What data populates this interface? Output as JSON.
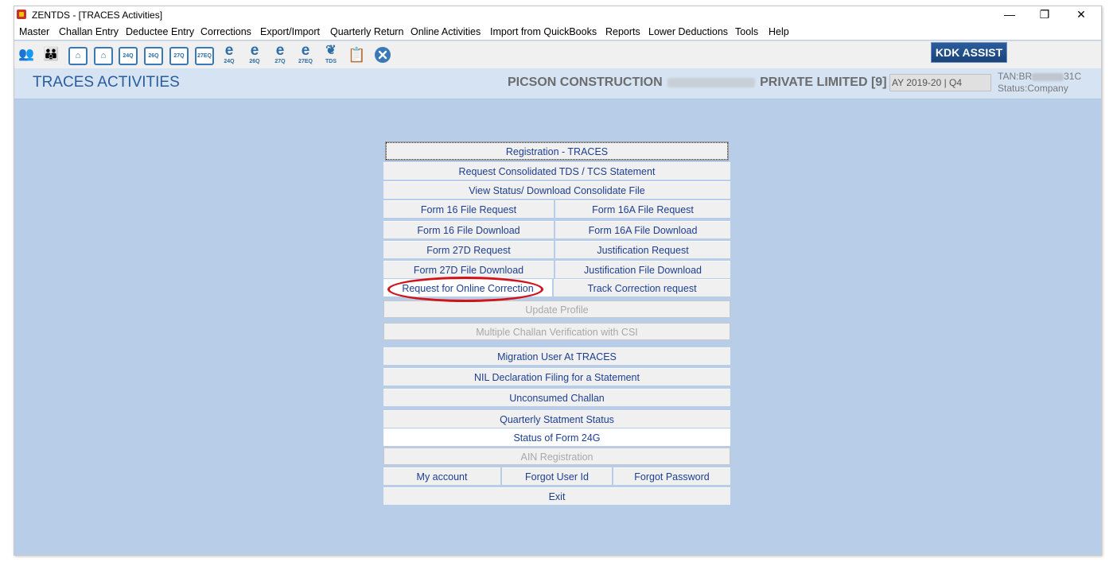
{
  "window": {
    "title": "ZENTDS - [TRACES Activities]",
    "controls": {
      "minimize": "—",
      "restore": "❐",
      "close": "✕"
    }
  },
  "menu": [
    "Master",
    "Challan Entry",
    "Deductee Entry",
    "Corrections",
    "Export/Import",
    "Quarterly Return",
    "Online Activities",
    "Import from QuickBooks",
    "Reports",
    "Lower Deductions",
    "Tools",
    "Help"
  ],
  "toolbar": {
    "icons": [
      "users-icon",
      "group-icon",
      "person-icon",
      "person-icon",
      "form-24q-icon",
      "form-26q-icon",
      "form-27q-icon",
      "form-27eq-icon",
      "e-24q-icon",
      "e-26q-icon",
      "e-27q-icon",
      "e-27eq-icon",
      "tds-icon",
      "document-icon",
      "close-circle-icon"
    ],
    "box_labels": [
      "24Q",
      "26Q",
      "27Q",
      "27EQ"
    ],
    "e_labels": [
      "24Q",
      "26Q",
      "27Q",
      "27EQ"
    ],
    "tds_label": "TDS",
    "kdk_assist": "KDK ASSIST"
  },
  "header": {
    "page_title": "TRACES ACTIVITIES",
    "company_prefix": "PICSON CONSTRUCTION",
    "company_suffix": "PRIVATE LIMITED [9]",
    "ay": "AY 2019-20 | Q4",
    "tan_prefix": "TAN:BR",
    "tan_suffix": "31C",
    "status": "Status:Company"
  },
  "buttons": {
    "registration": "Registration - TRACES",
    "request_consolidated": "Request Consolidated TDS / TCS Statement",
    "view_status": "View Status/ Download Consolidate File",
    "form16_request": "Form 16 File Request",
    "form16a_request": "Form 16A File Request",
    "form16_download": "Form 16 File Download",
    "form16a_download": "Form 16A File Download",
    "form27d_request": "Form 27D Request",
    "justification_request": "Justification Request",
    "form27d_download": "Form 27D File Download",
    "justification_download": "Justification File Download",
    "online_correction": "Request for Online Correction",
    "track_correction": "Track Correction request",
    "update_profile": "Update Profile",
    "multiple_challan": "Multiple Challan Verification with CSI",
    "migration_user": "Migration User At TRACES",
    "nil_declaration": "NIL Declaration Filing for a Statement",
    "unconsumed_challan": "Unconsumed Challan",
    "quarterly_status": "Quarterly Statment Status",
    "status_24g": "Status of Form 24G",
    "ain_registration": "AIN Registration",
    "my_account": "My account",
    "forgot_user": "Forgot User Id",
    "forgot_password": "Forgot Password",
    "exit": "Exit"
  },
  "colors": {
    "background": "#b8cde8",
    "link_text": "#1d3f91",
    "disabled_text": "#a8a8a8",
    "highlight": "#d0141a",
    "kdk_button": "#1b447a"
  }
}
